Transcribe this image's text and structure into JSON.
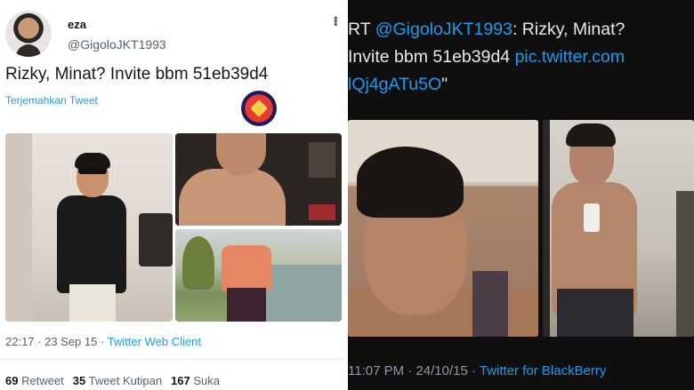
{
  "left_tweet": {
    "name": "eza",
    "handle": "@GigoloJKT1993",
    "text": "Rizky, Minat? Invite bbm 51eb39d4",
    "translate_label": "Terjemahkan Tweet",
    "more_icon": "ellipsis-icon",
    "timestamp": "22:17 · 23 Sep 15 · ",
    "client": "Twitter Web Client",
    "stats": {
      "retweets_count": "69",
      "retweets_label": "Retweet",
      "quotes_count": "35",
      "quotes_label": "Tweet Kutipan",
      "likes_count": "167",
      "likes_label": "Suka"
    }
  },
  "right_tweet": {
    "line1_prefix": "RT ",
    "line1_mention": "@GigoloJKT1993",
    "line1_text": ": Rizky, Minat?",
    "line2_text": "Invite bbm 51eb39d4 ",
    "line2_link": "pic.twitter.com",
    "line3_link": "lQj4gATu5O",
    "line3_text": "\"",
    "timestamp": "11:07 PM · 24/10/15 · ",
    "client": "Twitter for BlackBerry"
  },
  "colors": {
    "link": "#1d9bf0",
    "dark_bg": "#0f0f10",
    "light_bg": "#ffffff"
  }
}
